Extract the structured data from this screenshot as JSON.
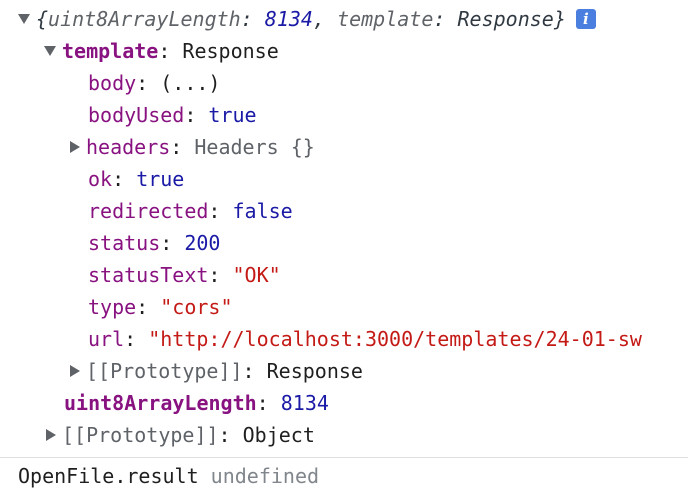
{
  "summary": {
    "open": "{",
    "k1": "uint8ArrayLength",
    "v1": "8134",
    "k2": "template",
    "v2": "Response",
    "close": "}"
  },
  "template": {
    "key": "template",
    "value": "Response",
    "props": [
      {
        "key": "body",
        "value": "(...)",
        "type": "obj"
      },
      {
        "key": "bodyUsed",
        "value": "true",
        "type": "bool"
      },
      {
        "key": "headers",
        "value": "Headers {}",
        "type": "objgray"
      },
      {
        "key": "ok",
        "value": "true",
        "type": "bool"
      },
      {
        "key": "redirected",
        "value": "false",
        "type": "bool"
      },
      {
        "key": "status",
        "value": "200",
        "type": "num"
      },
      {
        "key": "statusText",
        "value": "\"OK\"",
        "type": "str"
      },
      {
        "key": "type",
        "value": "\"cors\"",
        "type": "str"
      },
      {
        "key": "url",
        "value": "\"http://localhost:3000/templates/24-01-sw",
        "type": "str"
      }
    ],
    "prototype_key": "[[Prototype]]",
    "prototype_value": "Response"
  },
  "uint8": {
    "key": "uint8ArrayLength",
    "value": "8134"
  },
  "root_prototype": {
    "key": "[[Prototype]]",
    "value": "Object"
  },
  "info_icon": "info-icon",
  "result": {
    "expr": "OpenFile.result",
    "value": "undefined"
  }
}
